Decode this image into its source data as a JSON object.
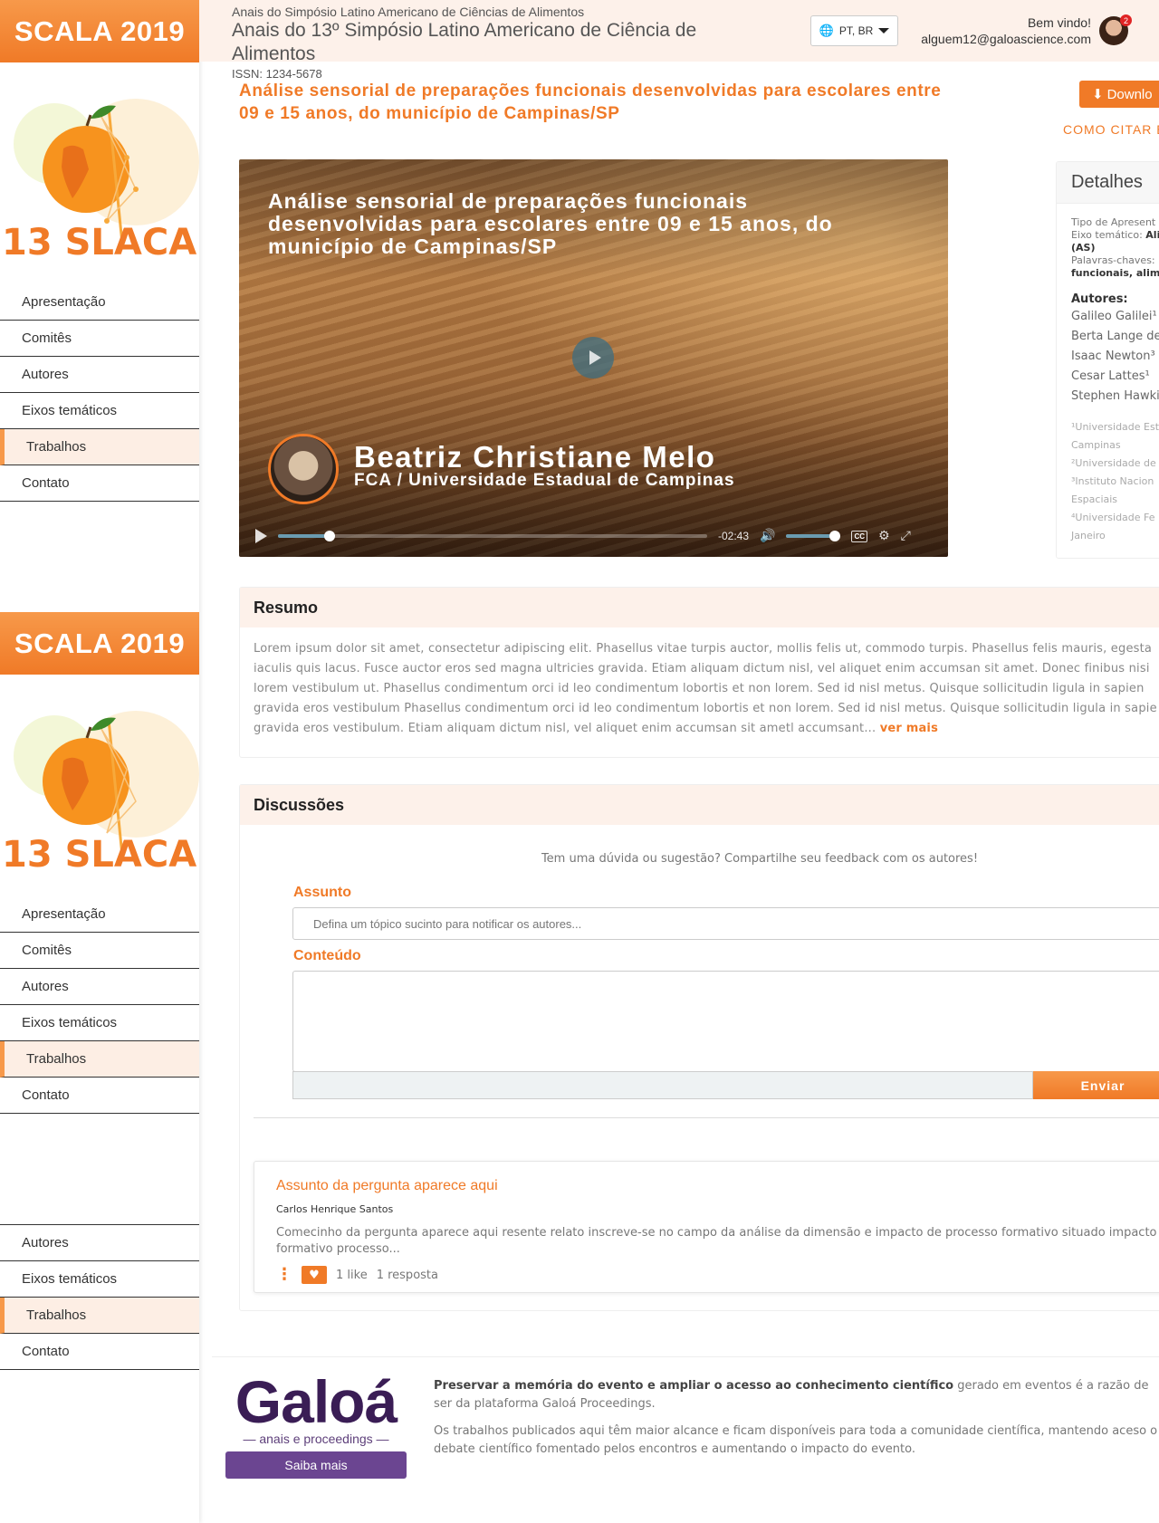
{
  "sidebar": {
    "banner": "SCALA 2019",
    "logo_text": "13 SLACA",
    "nav_items": [
      "Apresentação",
      "Comitês",
      "Autores",
      "Eixos temáticos",
      "Trabalhos",
      "Contato"
    ],
    "partial_nav_items": [
      "Autores",
      "Eixos temáticos",
      "Trabalhos",
      "Contato"
    ],
    "active_item": "Trabalhos"
  },
  "header": {
    "subtitle": "Anais do Simpósio Latino Americano de Ciências de Alimentos",
    "title": "Anais do 13º Simpósio Latino Americano de Ciência de Alimentos",
    "issn": "ISSN: 1234-5678",
    "language": "PT, BR",
    "welcome": "Bem vindo!",
    "email": "alguem12@galoascience.com",
    "notifications": "2"
  },
  "paper": {
    "title": "Análise sensorial de preparações funcionais desenvolvidas para escolares entre 09 e 15 anos, do município de Campinas/SP",
    "download_label": "Downlo",
    "cite_label": "COMO CITAR E"
  },
  "video": {
    "title": "Análise sensorial de preparações funcionais desenvolvidas para escolares entre 09 e 15 anos, do município de Campinas/SP",
    "speaker_name": "Beatriz Christiane Melo",
    "speaker_institution": "FCA / Universidade Estadual de Campinas",
    "time_remaining": "-02:43",
    "progress_fraction": 0.12,
    "volume_fraction": 0.9,
    "cc_label": "CC"
  },
  "details": {
    "heading": "Detalhes",
    "tipo_label": "Tipo de Apresent",
    "eixo_label": "Eixo temático:",
    "eixo_value": "Ali",
    "eixo_value_cont": "(AS)",
    "palavras_label": "Palavras-chaves:",
    "palavras_value": "funcionais, alime",
    "authors_heading": "Autores:",
    "authors": [
      "Galileo Galilei¹",
      "Berta Lange de",
      "Isaac Newton³",
      "Cesar Lattes¹",
      "Stephen Hawki"
    ],
    "affiliations": [
      "¹Universidade Est",
      "Campinas",
      "²Universidade de",
      "³Instituto Nacion",
      "Espaciais",
      "⁴Universidade Fe",
      "Janeiro"
    ]
  },
  "resumo": {
    "heading": "Resumo",
    "text": "Lorem ipsum dolor sit amet, consectetur adipiscing elit. Phasellus vitae turpis auctor, mollis felis ut, commodo turpis. Phasellus felis mauris, egesta iaculis quis lacus. Fusce auctor eros sed magna ultricies gravida. Etiam aliquam dictum nisl, vel aliquet enim accumsan sit amet. Donec finibus nisi lorem vestibulum ut. Phasellus condimentum orci id leo condimentum lobortis et non lorem. Sed id nisl metus. Quisque sollicitudin ligula in sapien gravida eros vestibulum Phasellus condimentum orci id leo condimentum lobortis et non lorem. Sed id nisl metus. Quisque sollicitudin ligula in sapie gravida eros vestibulum. Etiam aliquam dictum nisl, vel aliquet enim accumsan sit ametl accumsant...",
    "more_label": "ver mais"
  },
  "discussions": {
    "heading": "Discussões",
    "prompt": "Tem uma dúvida ou sugestão? Compartilhe seu feedback com os autores!",
    "subject_label": "Assunto",
    "subject_placeholder": "Defina um tópico sucinto para notificar os autores...",
    "content_label": "Conteúdo",
    "send_label": "Enviar",
    "question": {
      "title": "Assunto da pergunta aparece aqui",
      "author": "Carlos Henrique Santos",
      "body": "Comecinho da pergunta aparece aqui resente relato inscreve-se no campo da análise da dimensão e impacto de processo formativo situado impacto d formativo processo...",
      "likes": "1 like",
      "replies": "1 resposta"
    }
  },
  "footer": {
    "logo_word": "Galoá",
    "logo_sub": "anais e proceedings",
    "button_label": "Saiba mais",
    "para1_bold": "Preservar a memória do evento e ampliar o acesso ao conhecimento científico",
    "para1_rest": " gerado em eventos é a razão de ser da plataforma Galoá Proceedings.",
    "para2": "Os trabalhos publicados aqui têm maior alcance e ficam disponíveis para toda a comunidade científica, mantendo aceso o debate científico fomentado pelos encontros e aumentando o impacto do evento."
  },
  "colors": {
    "accent": "#f07a27",
    "accent_light": "#f7994a",
    "header_bg": "#fdf1ea",
    "galoa_purple": "#3a1d55"
  }
}
